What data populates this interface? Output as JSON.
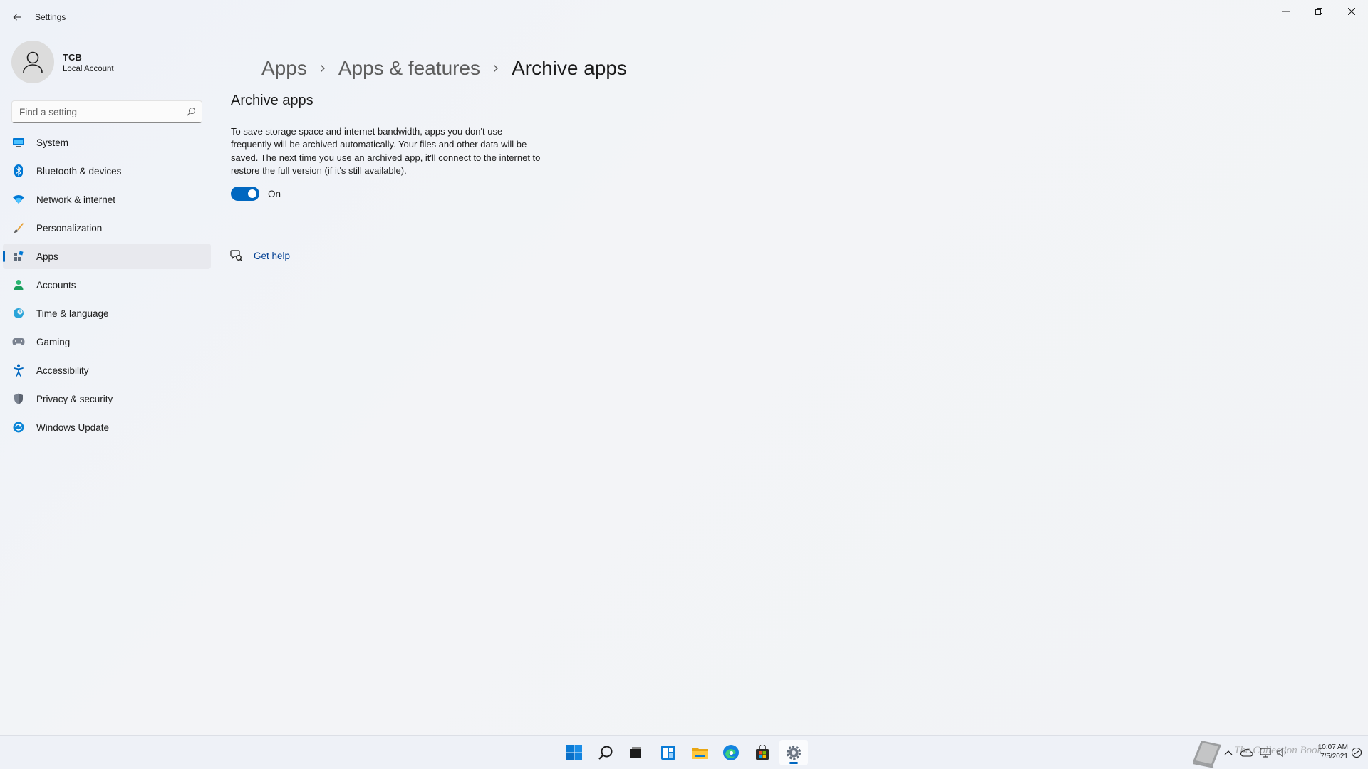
{
  "window": {
    "title": "Settings"
  },
  "profile": {
    "name": "TCB",
    "account_type": "Local Account"
  },
  "search": {
    "placeholder": "Find a setting",
    "value": ""
  },
  "sidebar": {
    "items": [
      {
        "label": "System",
        "icon": "system-icon"
      },
      {
        "label": "Bluetooth & devices",
        "icon": "bluetooth-icon"
      },
      {
        "label": "Network & internet",
        "icon": "wifi-icon"
      },
      {
        "label": "Personalization",
        "icon": "brush-icon"
      },
      {
        "label": "Apps",
        "icon": "apps-icon",
        "active": true
      },
      {
        "label": "Accounts",
        "icon": "person-icon"
      },
      {
        "label": "Time & language",
        "icon": "globe-clock-icon"
      },
      {
        "label": "Gaming",
        "icon": "gamepad-icon"
      },
      {
        "label": "Accessibility",
        "icon": "accessibility-icon"
      },
      {
        "label": "Privacy & security",
        "icon": "shield-icon"
      },
      {
        "label": "Windows Update",
        "icon": "update-icon"
      }
    ]
  },
  "breadcrumb": {
    "items": [
      "Apps",
      "Apps & features",
      "Archive apps"
    ]
  },
  "main": {
    "section_title": "Archive apps",
    "description": "To save storage space and internet bandwidth, apps you don't use frequently will be archived automatically. Your files and other data will be saved. The next time you use an archived app, it'll connect to the internet to restore the full version (if it's still available).",
    "toggle_state": "On",
    "toggle_on": true,
    "help_label": "Get help"
  },
  "taskbar": {
    "icons": [
      "start-icon",
      "search-icon",
      "task-view-icon",
      "widgets-icon",
      "file-explorer-icon",
      "edge-icon",
      "store-icon",
      "settings-icon"
    ],
    "active": "settings-icon",
    "clock_time": "10:07 AM",
    "clock_date": "7/5/2021",
    "watermark": "The Collection Book"
  },
  "colors": {
    "accent": "#0067c0",
    "link": "#003e92",
    "window_bg": "#f3f3f3",
    "nav_active_bg": "#e8e9ee"
  }
}
